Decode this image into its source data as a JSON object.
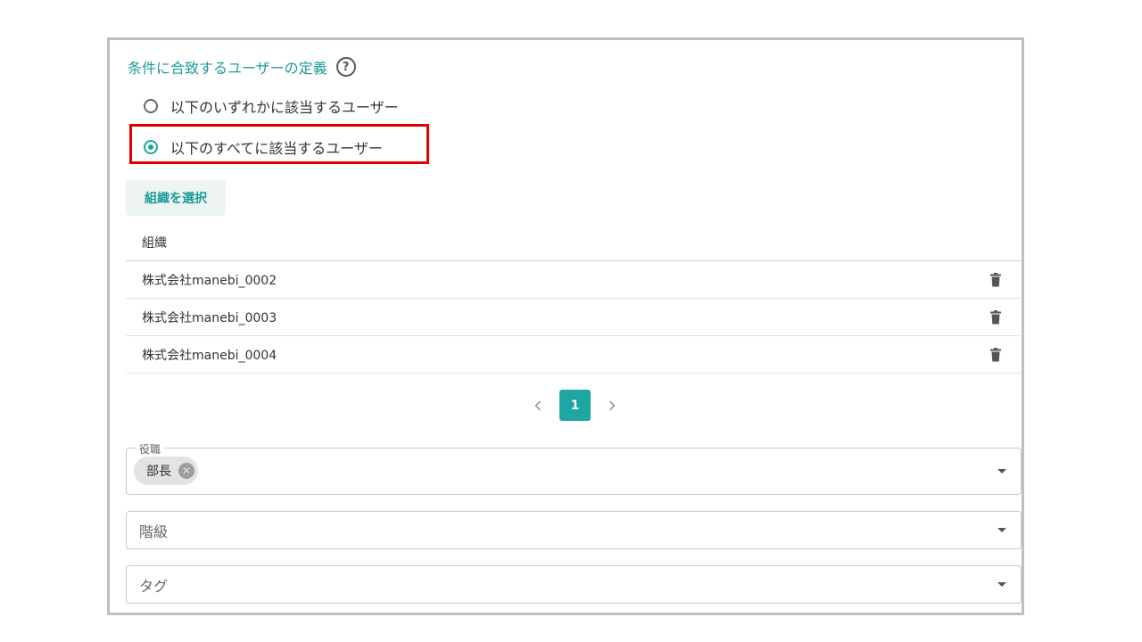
{
  "section": {
    "title": "条件に合致するユーザーの定義"
  },
  "radios": [
    {
      "label": "以下のいずれかに該当するユーザー",
      "checked": false
    },
    {
      "label": "以下のすべてに該当するユーザー",
      "checked": true
    }
  ],
  "select_org_button": "組織を選択",
  "org_table": {
    "header": "組織",
    "rows": [
      {
        "name": "株式会社manebi_0002"
      },
      {
        "name": "株式会社manebi_0003"
      },
      {
        "name": "株式会社manebi_0004"
      }
    ]
  },
  "pagination": {
    "current_page": "1",
    "prev_icon": "chevron-left",
    "next_icon": "chevron-right"
  },
  "position_field": {
    "legend": "役職",
    "chips": [
      {
        "label": "部長"
      }
    ]
  },
  "rank_field": {
    "placeholder": "階級"
  },
  "tag_field": {
    "placeholder": "タグ"
  },
  "colors": {
    "accent": "#1ea6a2",
    "highlight": "#e00000"
  }
}
